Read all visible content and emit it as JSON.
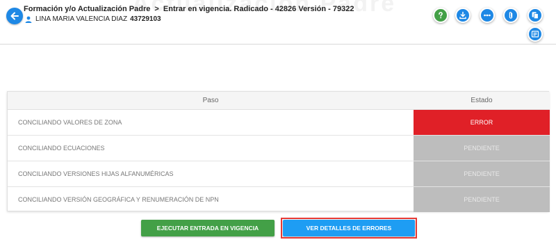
{
  "header": {
    "watermark": "Actualización Padre",
    "breadcrumb_part1": "Formación y/o Actualización Padre",
    "breadcrumb_sep": ">",
    "breadcrumb_part2": "Entrar en vigencia. Radicado - 42826 Versión - 79322",
    "user_name": "LINA MARIA VALENCIA DIAZ",
    "user_id": "43729103"
  },
  "toolbar": {
    "icons": [
      "help-icon",
      "download-icon",
      "more-icon",
      "attach-icon",
      "copy-icon",
      "notes-icon"
    ]
  },
  "table": {
    "headers": {
      "paso": "Paso",
      "estado": "Estado"
    },
    "rows": [
      {
        "paso": "CONCILIANDO VALORES DE ZONA",
        "estado": "ERROR"
      },
      {
        "paso": "CONCILIANDO ECUACIONES",
        "estado": "PENDIENTE"
      },
      {
        "paso": "CONCILIANDO VERSIONES HIJAS ALFANUMÉRICAS",
        "estado": "PENDIENTE"
      },
      {
        "paso": "CONCILIANDO VERSIÓN GEOGRÁFICA Y RENUMERACIÓN DE NPN",
        "estado": "PENDIENTE"
      }
    ]
  },
  "actions": {
    "execute_label": "EJECUTAR ENTRADA EN VIGENCIA",
    "details_label": "VER DETALLES DE ERRORES"
  },
  "colors": {
    "primary": "#1e88e5",
    "success": "#43a047",
    "error": "#e02027",
    "pending": "#bdbdbd",
    "highlight": "#e53935"
  }
}
